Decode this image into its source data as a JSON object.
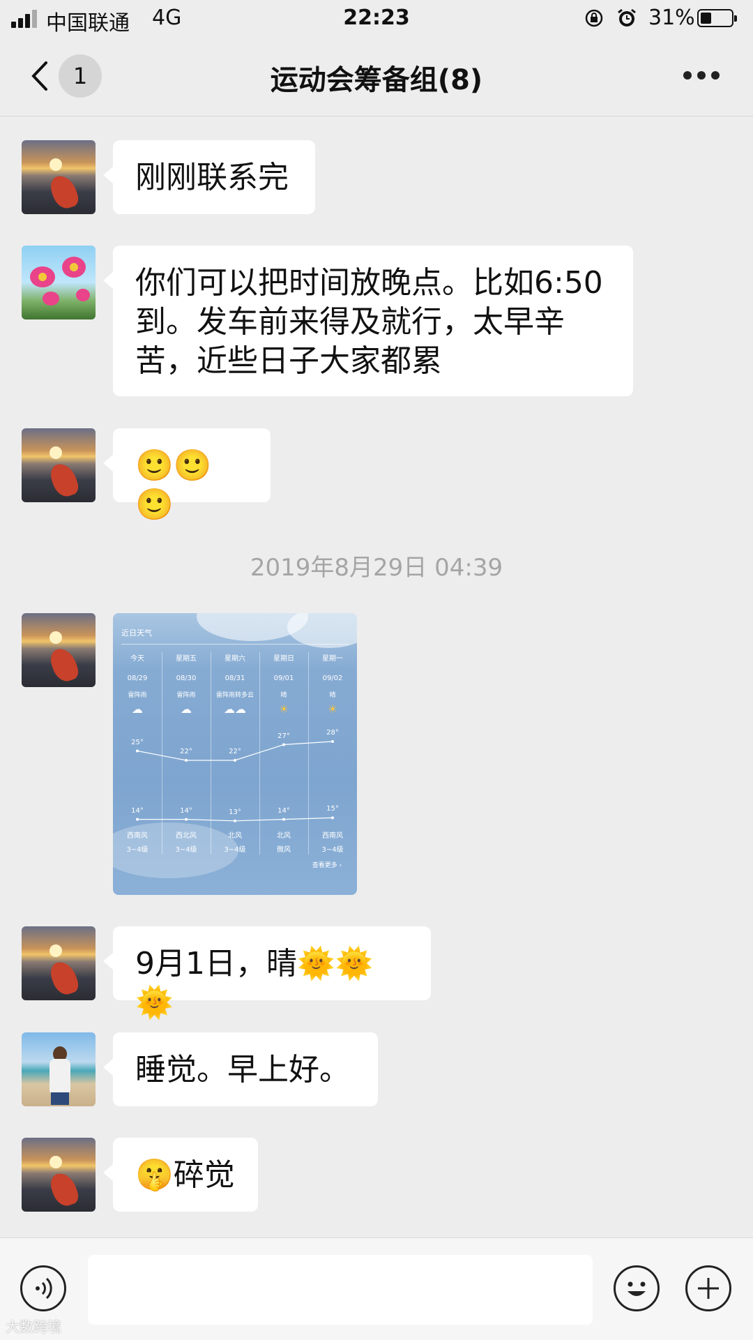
{
  "status_bar": {
    "carrier": "中国联通",
    "network": "4G",
    "time": "22:23",
    "battery_percent_label": "31%",
    "battery_level": 0.31
  },
  "nav": {
    "unread_count": "1",
    "title": "运动会筹备组(8)"
  },
  "messages": [
    {
      "text": "刚刚联系完"
    },
    {
      "text": "你们可以把时间放晚点。比如6:50到。发车前来得及就行，太早辛苦，近些日子大家都累",
      "lines": [
        "你们可以把时间放晚点。比如6:50",
        "到。发车前来得及就行，太早辛",
        "苦，近些日子大家都累"
      ]
    },
    {
      "text": "🙂🙂🙂"
    },
    {
      "timestamp": "2019年8月29日 04:39"
    },
    {
      "text": "9月1日，晴🌞🌞🌞"
    },
    {
      "text": "睡觉。早上好。"
    },
    {
      "text": "🤫碎觉"
    }
  ],
  "weather_card": {
    "title": "近日天气",
    "days": [
      {
        "name": "今天",
        "date": "08/29",
        "condition": "雷阵雨",
        "high": "25°",
        "low": "14°",
        "wind_dir": "西南风",
        "wind_level": "3~4级"
      },
      {
        "name": "星期五",
        "date": "08/30",
        "condition": "雷阵雨",
        "high": "22°",
        "low": "14°",
        "wind_dir": "西北风",
        "wind_level": "3~4级"
      },
      {
        "name": "星期六",
        "date": "08/31",
        "condition": "雷阵雨转多云",
        "high": "22°",
        "low": "13°",
        "wind_dir": "北风",
        "wind_level": "3~4级"
      },
      {
        "name": "星期日",
        "date": "09/01",
        "condition": "晴",
        "high": "27°",
        "low": "14°",
        "wind_dir": "北风",
        "wind_level": "微风"
      },
      {
        "name": "星期一",
        "date": "09/02",
        "condition": "晴",
        "high": "28°",
        "low": "15°",
        "wind_dir": "西南风",
        "wind_level": "3~4级"
      }
    ],
    "more_label": "查看更多 ›"
  },
  "watermark": "大数跨境",
  "icons": {
    "voice": "voice-icon",
    "emoji": "emoji-icon",
    "add": "plus-icon",
    "back": "chevron-left-icon",
    "more": "more-dots-icon"
  }
}
